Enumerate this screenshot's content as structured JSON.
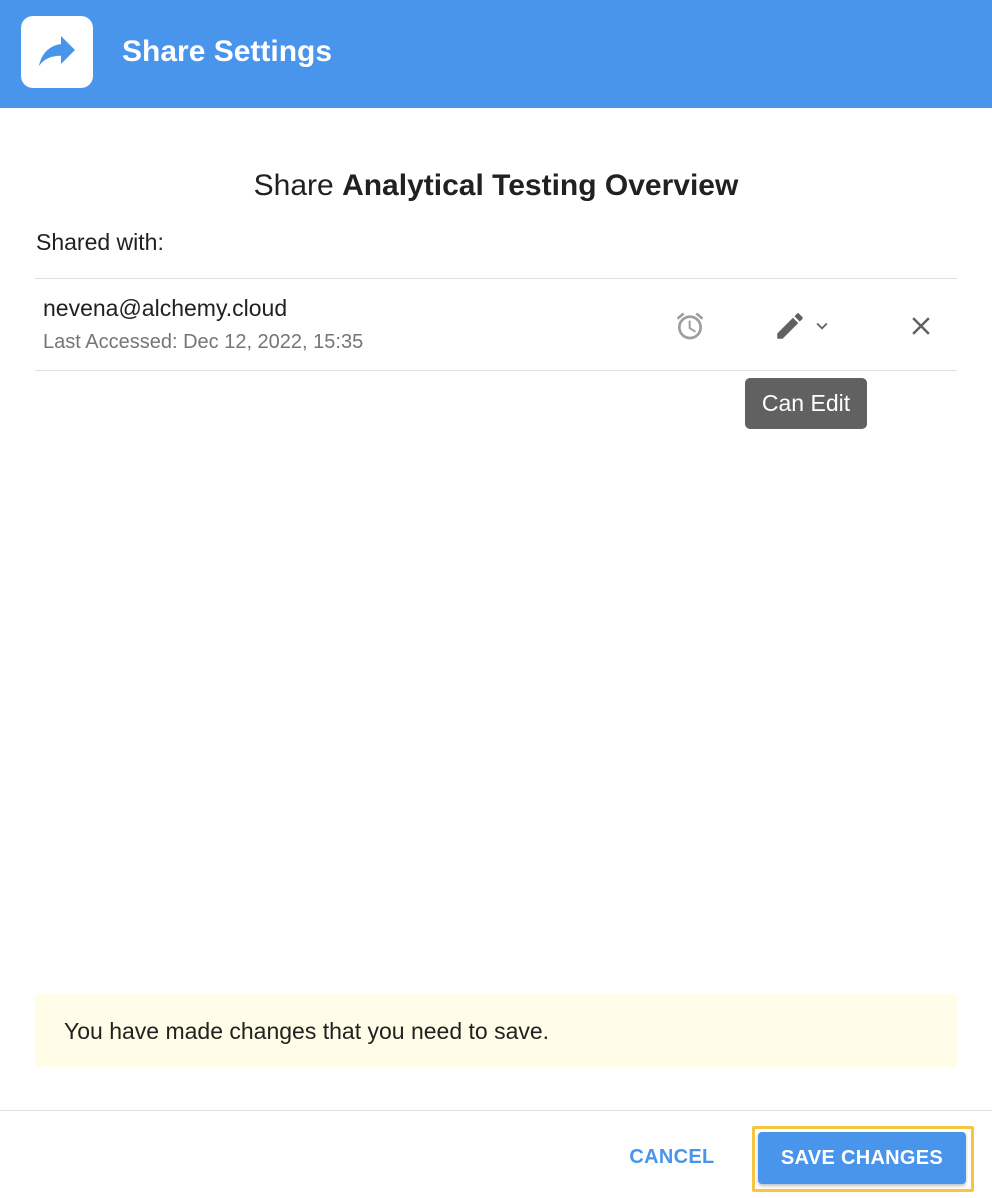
{
  "header": {
    "title": "Share Settings",
    "icon": "share-forward-icon",
    "background_color": "#4a95ec"
  },
  "heading": {
    "prefix": "Share ",
    "document_name": "Analytical Testing Overview"
  },
  "shared_with_label": "Shared with:",
  "shares": [
    {
      "email": "nevena@alchemy.cloud",
      "last_accessed": "Last Accessed: Dec 12, 2022, 15:35",
      "expiry_icon": "alarm-clock-icon",
      "permission_icon": "pencil-icon",
      "permission_dropdown_icon": "chevron-down-icon",
      "remove_icon": "close-icon"
    }
  ],
  "tooltip": {
    "text": "Can Edit"
  },
  "warning": {
    "text": "You have made changes that you need to save.",
    "background_color": "#fffde7"
  },
  "footer": {
    "cancel_label": "CANCEL",
    "save_label": "SAVE CHANGES",
    "accent_color": "#4a95ec",
    "focus_color": "#f6c544"
  }
}
